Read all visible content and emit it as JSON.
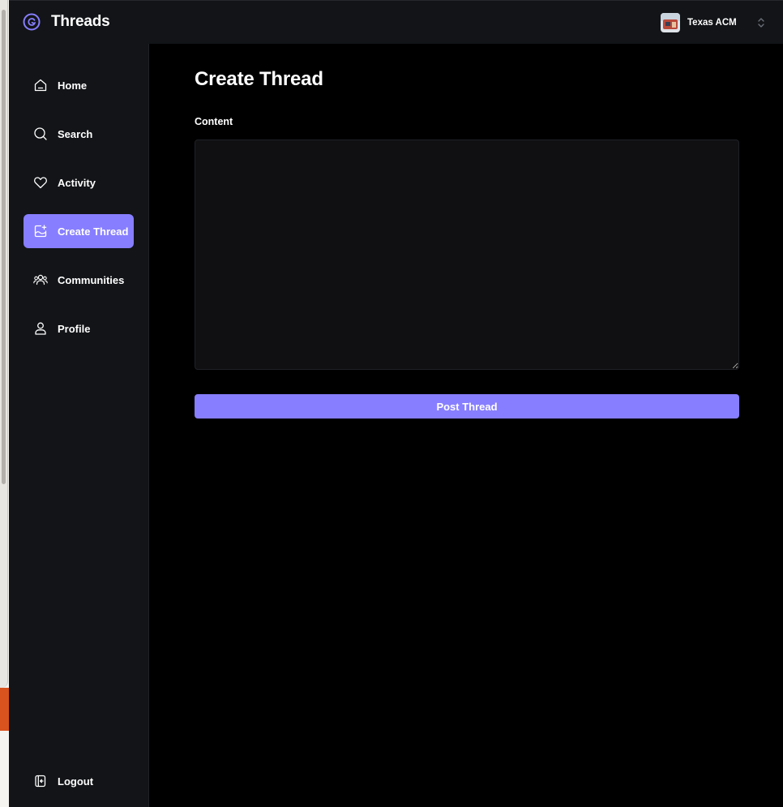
{
  "app": {
    "name": "Threads"
  },
  "org": {
    "name": "Texas ACM"
  },
  "sidebar": {
    "items": [
      {
        "label": "Home",
        "icon": "home-icon",
        "active": false
      },
      {
        "label": "Search",
        "icon": "search-icon",
        "active": false
      },
      {
        "label": "Activity",
        "icon": "heart-icon",
        "active": false
      },
      {
        "label": "Create Thread",
        "icon": "create-thread-icon",
        "active": true
      },
      {
        "label": "Communities",
        "icon": "users-icon",
        "active": false
      },
      {
        "label": "Profile",
        "icon": "user-icon",
        "active": false
      }
    ],
    "logout": {
      "label": "Logout",
      "icon": "logout-icon"
    }
  },
  "main": {
    "title": "Create Thread",
    "content_label": "Content",
    "content_value": "",
    "submit_label": "Post Thread"
  },
  "colors": {
    "accent": "#877eff",
    "sidebar_bg": "#121417",
    "main_bg": "#000000",
    "input_bg": "#101012"
  }
}
